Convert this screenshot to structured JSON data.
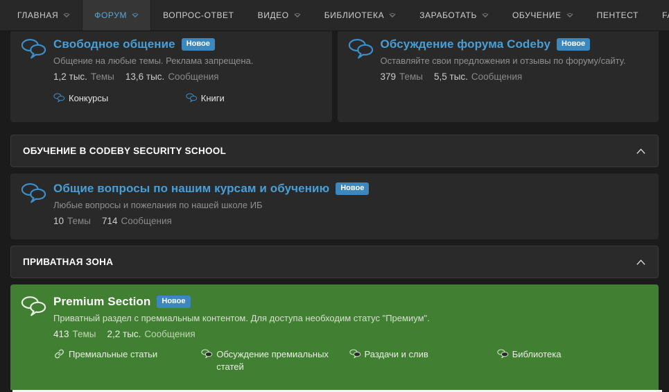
{
  "nav": {
    "items": [
      {
        "label": "ГЛАВНАЯ",
        "has_dropdown": true,
        "active": false
      },
      {
        "label": "ФОРУМ",
        "has_dropdown": true,
        "active": true
      },
      {
        "label": "ВОПРОС-ОТВЕТ",
        "has_dropdown": false,
        "active": false
      },
      {
        "label": "ВИДЕО",
        "has_dropdown": true,
        "active": false
      },
      {
        "label": "БИБЛИОТЕКА",
        "has_dropdown": true,
        "active": false
      },
      {
        "label": "ЗАРАБОТАТЬ",
        "has_dropdown": true,
        "active": false
      },
      {
        "label": "ОБУЧЕНИЕ",
        "has_dropdown": true,
        "active": false
      },
      {
        "label": "ПЕНТЕСТ",
        "has_dropdown": false,
        "active": false
      },
      {
        "label": "FAQ",
        "has_dropdown": false,
        "active": false
      }
    ]
  },
  "sections": {
    "school": {
      "title": "ОБУЧЕНИЕ В CODEBY SECURITY SCHOOL"
    },
    "private": {
      "title": "ПРИВАТНАЯ ЗОНА"
    }
  },
  "forums": {
    "free_chat": {
      "title": "Свободное общение",
      "badge": "Новое",
      "description": "Общение на любые темы. Реклама запрещена.",
      "topics_value": "1,2 тыс.",
      "topics_label": "Темы",
      "messages_value": "13,6 тыс.",
      "messages_label": "Сообщения",
      "subforums": [
        {
          "label": "Конкурсы"
        },
        {
          "label": "Книги"
        }
      ]
    },
    "codeby_discussion": {
      "title": "Обсуждение форума Codeby",
      "badge": "Новое",
      "description": "Оставляйте свои предложения и отзывы по форуму/сайту.",
      "topics_value": "379",
      "topics_label": "Темы",
      "messages_value": "5,5 тыс.",
      "messages_label": "Сообщения"
    },
    "course_questions": {
      "title": "Общие вопросы по нашим курсам и обучению",
      "badge": "Новое",
      "description": "Любые вопросы и пожелания по нашей школе ИБ",
      "topics_value": "10",
      "topics_label": "Темы",
      "messages_value": "714",
      "messages_label": "Сообщения"
    },
    "premium": {
      "title": "Premium Section",
      "badge": "Новое",
      "description": "Приватный раздел с премиальным контентом. Для доступа необходим статус \"Премиум\".",
      "topics_value": "413",
      "topics_label": "Темы",
      "messages_value": "2,2 тыс.",
      "messages_label": "Сообщения",
      "subforums": [
        {
          "label": "Премиальные статьи",
          "icon": "link"
        },
        {
          "label": "Обсуждение премиальных статей",
          "icon": "comments"
        },
        {
          "label": "Раздачи и слив",
          "icon": "comments"
        },
        {
          "label": "Библиотека",
          "icon": "comments"
        }
      ]
    }
  },
  "colors": {
    "accent_blue": "#479fd6",
    "badge_blue": "#3d87bf",
    "premium_green": "#417f33",
    "page_background": "#1b1b1b",
    "card_background": "#292929"
  }
}
